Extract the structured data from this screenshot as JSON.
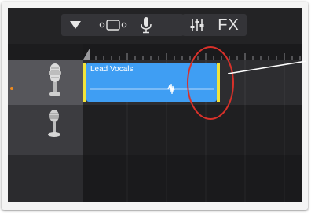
{
  "toolbar": {
    "tools": [
      {
        "icon": "triangle-down-icon"
      },
      {
        "icon": "loop-browser-icon"
      },
      {
        "icon": "microphone-icon"
      },
      {
        "icon": "mixer-sliders-icon"
      },
      {
        "label": "FX"
      }
    ]
  },
  "tracks": [
    {
      "icon": "condenser-mic-icon",
      "selected": true,
      "record_indicator": "#ef8a1d"
    },
    {
      "icon": "vintage-mic-icon",
      "selected": false
    }
  ],
  "region": {
    "label": "Lead Vocals",
    "color": "#3f9ef3",
    "trim_handle_color": "#f1e43a"
  },
  "colors": {
    "annotation": "#d9312a"
  }
}
